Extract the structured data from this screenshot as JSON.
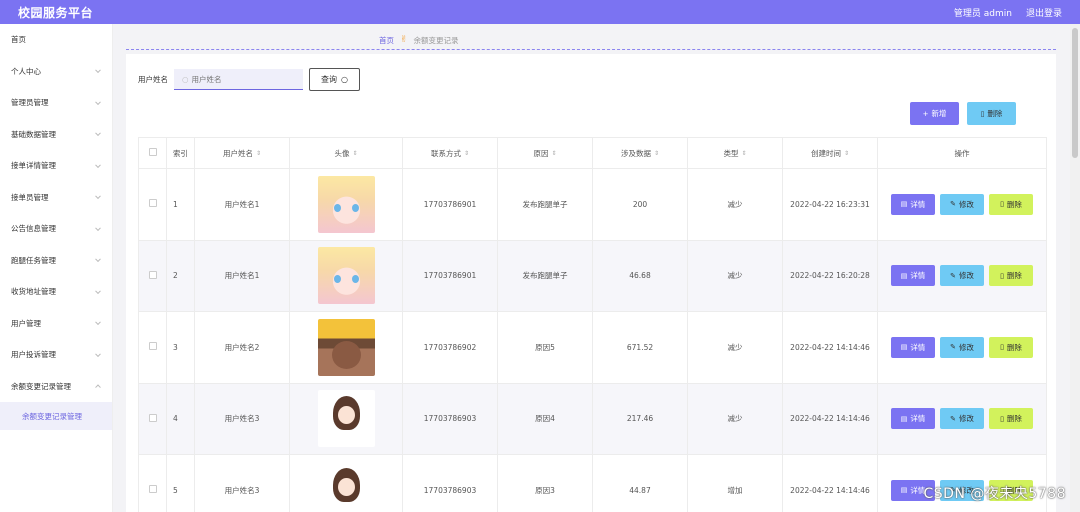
{
  "header": {
    "title": "校园服务平台",
    "user": "管理员 admin",
    "logout": "退出登录"
  },
  "sidebar": {
    "items": [
      {
        "label": "首页",
        "chev": false
      },
      {
        "label": "个人中心",
        "chev": true
      },
      {
        "label": "管理员管理",
        "chev": true
      },
      {
        "label": "基础数据管理",
        "chev": true
      },
      {
        "label": "接单详情管理",
        "chev": true
      },
      {
        "label": "接单员管理",
        "chev": true
      },
      {
        "label": "公告信息管理",
        "chev": true
      },
      {
        "label": "跑腿任务管理",
        "chev": true
      },
      {
        "label": "收货地址管理",
        "chev": true
      },
      {
        "label": "用户管理",
        "chev": true
      },
      {
        "label": "用户投诉管理",
        "chev": true
      },
      {
        "label": "余额变更记录管理",
        "chev": true
      }
    ],
    "sub_item": "余额变更记录管理"
  },
  "breadcrumb": {
    "home": "首页",
    "sep": "✌",
    "current": "余额变更记录"
  },
  "search": {
    "label": "用户姓名",
    "placeholder": "用户姓名",
    "value": "",
    "button": "查询"
  },
  "actions": {
    "add": "新增",
    "delete": "删除"
  },
  "table": {
    "headers": [
      "",
      "索引",
      "用户姓名",
      "头像",
      "联系方式",
      "原因",
      "涉及数据",
      "类型",
      "创建时间",
      "操作"
    ],
    "rows": [
      {
        "index": "1",
        "name": "用户姓名1",
        "avatar": "anime-girl-avatar",
        "phone": "17703786901",
        "reason": "发布跑腿单子",
        "amount": "200",
        "type": "减少",
        "created": "2022-04-22 16:23:31"
      },
      {
        "index": "2",
        "name": "用户姓名1",
        "avatar": "anime-girl-avatar",
        "phone": "17703786901",
        "reason": "发布跑腿单子",
        "amount": "46.68",
        "type": "减少",
        "created": "2022-04-22 16:20:28"
      },
      {
        "index": "3",
        "name": "用户姓名2",
        "avatar": "cartoon-boy-avatar",
        "phone": "17703786902",
        "reason": "原因5",
        "amount": "671.52",
        "type": "减少",
        "created": "2022-04-22 14:14:46"
      },
      {
        "index": "4",
        "name": "用户姓名3",
        "avatar": "cartoon-girl-avatar",
        "phone": "17703786903",
        "reason": "原因4",
        "amount": "217.46",
        "type": "减少",
        "created": "2022-04-22 14:14:46"
      },
      {
        "index": "5",
        "name": "用户姓名3",
        "avatar": "cartoon-girl-avatar",
        "phone": "17703786903",
        "reason": "原因3",
        "amount": "44.87",
        "type": "增加",
        "created": "2022-04-22 14:14:46"
      }
    ],
    "row_buttons": {
      "detail": "详情",
      "edit": "修改",
      "remove": "删除"
    }
  },
  "watermark": "CSDN @夜未央5788",
  "colors": {
    "primary": "#7b73f2",
    "edit": "#6fcaf4",
    "remove": "#d2f25c",
    "accent": "#f2a23a"
  }
}
